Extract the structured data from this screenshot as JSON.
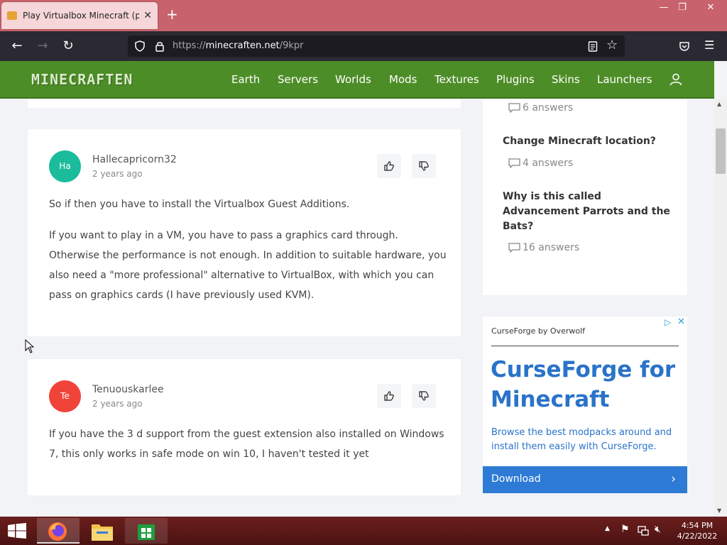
{
  "browser": {
    "tab_title": "Play Virtualbox Minecraft (probl",
    "url_proto": "https://",
    "url_host": "minecraften.net",
    "url_path": "/9kpr"
  },
  "site": {
    "logo": "MINECRAFTEN",
    "nav": [
      "Earth",
      "Servers",
      "Worlds",
      "Mods",
      "Textures",
      "Plugins",
      "Skins",
      "Launchers"
    ]
  },
  "answers": [
    {
      "avatar": "Ha",
      "avatar_color": "#1abc9c",
      "author": "Hallecapricorn32",
      "time": "2 years ago",
      "paragraphs": [
        "So if then you have to install the Virtualbox Guest Additions.",
        "If you want to play in a VM, you have to pass a graphics card through. Otherwise the performance is not enough. In addition to suitable hardware, you also need a \"more professional\" alternative to VirtualBox, with which you can pass on graphics cards (I have previously used KVM)."
      ]
    },
    {
      "avatar": "Te",
      "avatar_color": "#f0443a",
      "author": "Tenuouskarlee",
      "time": "2 years ago",
      "paragraphs": [
        "If you have the 3 d support from the guest extension also installed on Windows 7, this only works in safe mode on win 10, I haven't tested it yet"
      ]
    }
  ],
  "sidebar": {
    "questions": [
      {
        "title": "",
        "answers": "6 answers"
      },
      {
        "title": "Change Minecraft location?",
        "answers": "4 answers"
      },
      {
        "title": "Why is this called Advancement Parrots and the Bats?",
        "answers": "16 answers"
      }
    ]
  },
  "ad": {
    "brand": "CurseForge by Overwolf",
    "heading": "CurseForge for Minecraft",
    "body": "Browse the best modpacks around and install them easily with CurseForge.",
    "button": "Download",
    "accent": "#2e7bd6"
  },
  "taskbar": {
    "time": "4:54 PM",
    "date": "4/22/2022"
  }
}
